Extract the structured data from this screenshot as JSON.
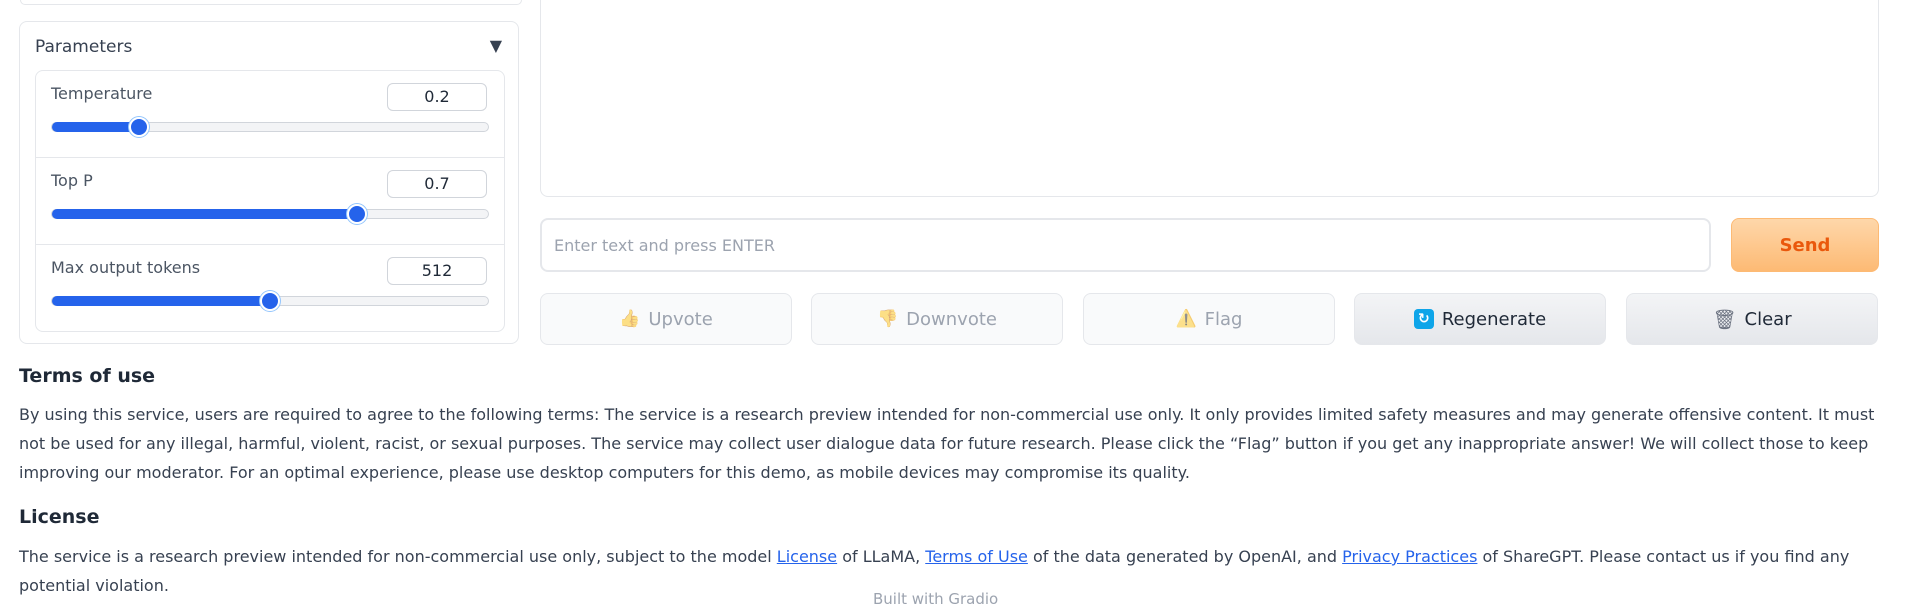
{
  "parameters": {
    "title": "Parameters",
    "toggle_icon": "triangle-down-icon",
    "sliders": [
      {
        "label": "Temperature",
        "value": "0.2",
        "fraction": 0.2
      },
      {
        "label": "Top P",
        "value": "0.7",
        "fraction": 0.7
      },
      {
        "label": "Max output tokens",
        "value": "512",
        "fraction": 0.5
      }
    ]
  },
  "chat": {
    "input_placeholder": "Enter text and press ENTER",
    "send_label": "Send"
  },
  "actions": {
    "upvote_label": "Upvote",
    "downvote_label": "Downvote",
    "flag_label": "Flag",
    "regenerate_label": "Regenerate",
    "clear_label": "Clear"
  },
  "terms": {
    "title": "Terms of use",
    "body": "By using this service, users are required to agree to the following terms: The service is a research preview intended for non-commercial use only. It only provides limited safety measures and may generate offensive content. It must not be used for any illegal, harmful, violent, racist, or sexual purposes. The service may collect user dialogue data for future research. Please click the “Flag” button if you get any inappropriate answer! We will collect those to keep improving our moderator. For an optimal experience, please use desktop computers for this demo, as mobile devices may compromise its quality."
  },
  "license": {
    "title": "License",
    "text_1": "The service is a research preview intended for non-commercial use only, subject to the model ",
    "link_license": "License",
    "text_2": " of LLaMA, ",
    "link_terms": "Terms of Use",
    "text_3": " of the data generated by OpenAI, and ",
    "link_privacy": "Privacy Practices",
    "text_4": " of ShareGPT. Please contact us if you find any potential violation."
  },
  "footer": {
    "built_with": "Built with Gradio"
  },
  "colors": {
    "accent_blue": "#2563eb",
    "send_orange": "#ea580c"
  }
}
